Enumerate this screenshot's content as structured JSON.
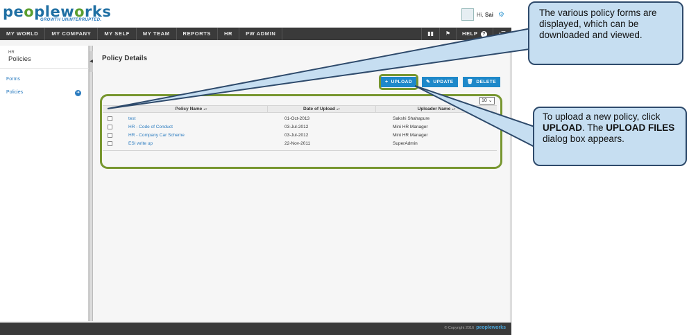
{
  "app": {
    "logo_text_a": "pe",
    "logo_text_b": "o",
    "logo_text_c": "plew",
    "logo_text_d": "o",
    "logo_text_e": "rks",
    "tagline": "GROWTH UNINTERRUPTED.",
    "greeting_prefix": "Hi,",
    "greeting_name": "Sai"
  },
  "nav": {
    "items": [
      "MY WORLD",
      "MY COMPANY",
      "MY SELF",
      "MY TEAM",
      "REPORTS",
      "HR",
      "PW ADMIN"
    ],
    "help_label": "HELP"
  },
  "sidebar": {
    "section_small": "HR",
    "section_title": "Policies",
    "links": [
      "Forms",
      "Policies"
    ]
  },
  "main": {
    "page_title": "Policy Details",
    "buttons": {
      "upload": "UPLOAD",
      "update": "UPDATE",
      "delete": "DELETE"
    },
    "page_size": "10",
    "columns": [
      "Policy Name",
      "Date of Upload",
      "Uploader Name"
    ],
    "rows": [
      {
        "name": "test",
        "date": "01-Oct-2013",
        "uploader": "Sakshi Shahapure"
      },
      {
        "name": "HR - Code of Conduct",
        "date": "03-Jul-2012",
        "uploader": "Mini HR Manager"
      },
      {
        "name": "HR - Company Car Scheme",
        "date": "03-Jul-2012",
        "uploader": "Mini HR Manager"
      },
      {
        "name": "ESI write up",
        "date": "22-Nov-2011",
        "uploader": "SuperAdmin"
      }
    ]
  },
  "footer": {
    "copyright": "© Copyright 2016",
    "logo": "peopleworks"
  },
  "callouts": {
    "first": "The various policy forms are displayed, which can be downloaded and viewed.",
    "second_a": "To upload a new policy, click ",
    "second_b": "UPLOAD",
    "second_c": ". The ",
    "second_d": "UPLOAD FILES",
    "second_e": " dialog box appears."
  },
  "colors": {
    "accent_blue": "#1e88c9",
    "highlight_green": "#77962f",
    "callout_fill": "#c6def1",
    "callout_border": "#2e4a6b",
    "nav_bg": "#3a3a3a"
  }
}
